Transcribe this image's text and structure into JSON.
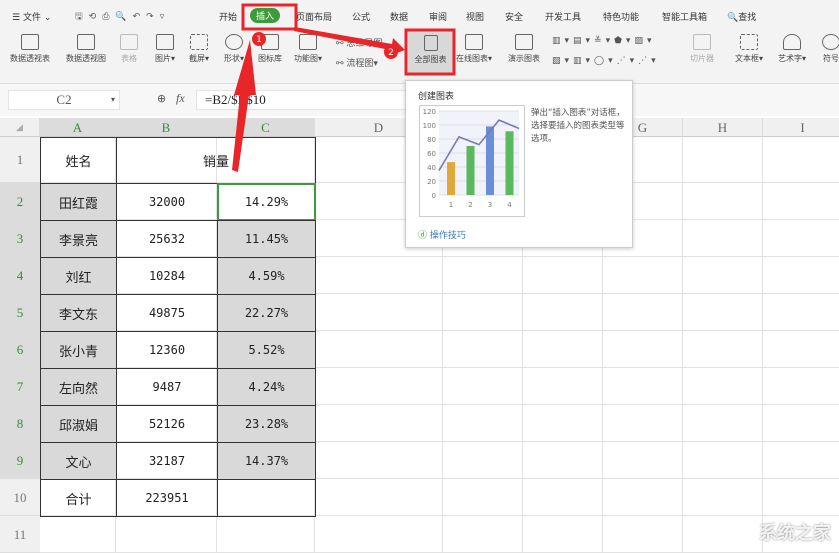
{
  "menu": {
    "file": "文件",
    "tabs": [
      "开始",
      "插入",
      "页面布局",
      "公式",
      "数据",
      "审阅",
      "视图",
      "安全",
      "开发工具",
      "特色功能",
      "智能工具箱"
    ],
    "search": "查找"
  },
  "ribbon": {
    "items": [
      "数据透视表",
      "数据透视图",
      "表格",
      "图片",
      "截屏",
      "形状",
      "图标库",
      "功能图",
      "全部图表",
      "在线图表",
      "演示图表",
      "切片器",
      "文本框",
      "艺术字",
      "符号"
    ],
    "mindmap": "思维导图",
    "flowchart": "流程图"
  },
  "formula_bar": {
    "cell_ref": "C2",
    "fx": "fx",
    "formula": "=B2/$B$10"
  },
  "columns": [
    "A",
    "B",
    "C",
    "D",
    "E",
    "F",
    "G",
    "H",
    "I"
  ],
  "rows": [
    "1",
    "2",
    "3",
    "4",
    "5",
    "6",
    "7",
    "8",
    "9",
    "10",
    "11"
  ],
  "table": {
    "header": {
      "name": "姓名",
      "sales": "销量"
    },
    "data": [
      [
        "田红霞",
        "32000",
        "14.29%"
      ],
      [
        "李景亮",
        "25632",
        "11.45%"
      ],
      [
        "刘红",
        "10284",
        "4.59%"
      ],
      [
        "李文东",
        "49875",
        "22.27%"
      ],
      [
        "张小青",
        "12360",
        "5.52%"
      ],
      [
        "左向然",
        "9487",
        "4.24%"
      ],
      [
        "邱淑娟",
        "52126",
        "23.28%"
      ],
      [
        "文心",
        "32187",
        "14.37%"
      ]
    ],
    "total": [
      "合计",
      "223951"
    ]
  },
  "tooltip": {
    "title": "创建图表",
    "desc": "弹出“插入图表”对话框，选择要插入的图表类型等选项。",
    "link": "操作技巧",
    "preview": {
      "yticks": [
        "0",
        "20",
        "40",
        "60",
        "80",
        "100",
        "120"
      ],
      "xticks": [
        "1",
        "2",
        "3",
        "4"
      ],
      "bars": [
        47,
        70,
        98,
        91
      ],
      "line": [
        35,
        83,
        72,
        107,
        95
      ],
      "colors": [
        "#e0a83a",
        "#5cb85c",
        "#6a8fd8",
        "#5cb85c"
      ]
    }
  },
  "annotations": {
    "step1": "1",
    "step2": "2",
    "color": "#e8262a"
  },
  "watermark": "系统之家"
}
